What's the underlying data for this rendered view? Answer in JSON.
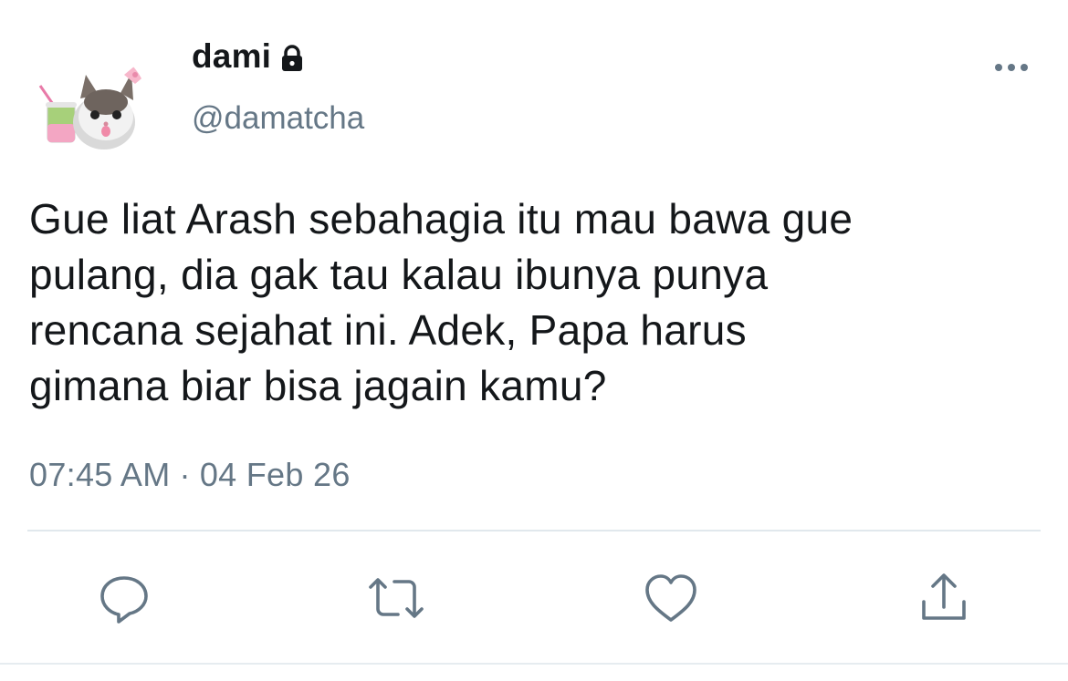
{
  "user": {
    "display_name": "dami",
    "handle": "@damatcha",
    "protected": true,
    "avatar_icon": "cat-avatar-icon"
  },
  "tweet": {
    "lines": [
      "Gue liat Arash sebahagia itu mau bawa gue",
      "pulang, dia gak tau kalau ibunya punya",
      "rencana sejahat ini. Adek, Papa harus",
      "gimana biar bisa jagain kamu?"
    ],
    "time": "07:45 AM",
    "separator": "·",
    "date": "04 Feb 26"
  },
  "actions": {
    "reply_icon": "reply-icon",
    "retweet_icon": "retweet-icon",
    "like_icon": "heart-icon",
    "share_icon": "share-icon",
    "more_icon": "more-dots-icon"
  },
  "colors": {
    "text": "#14171a",
    "secondary": "#657786",
    "icon": "#657786",
    "divider": "#e1e8ed"
  }
}
